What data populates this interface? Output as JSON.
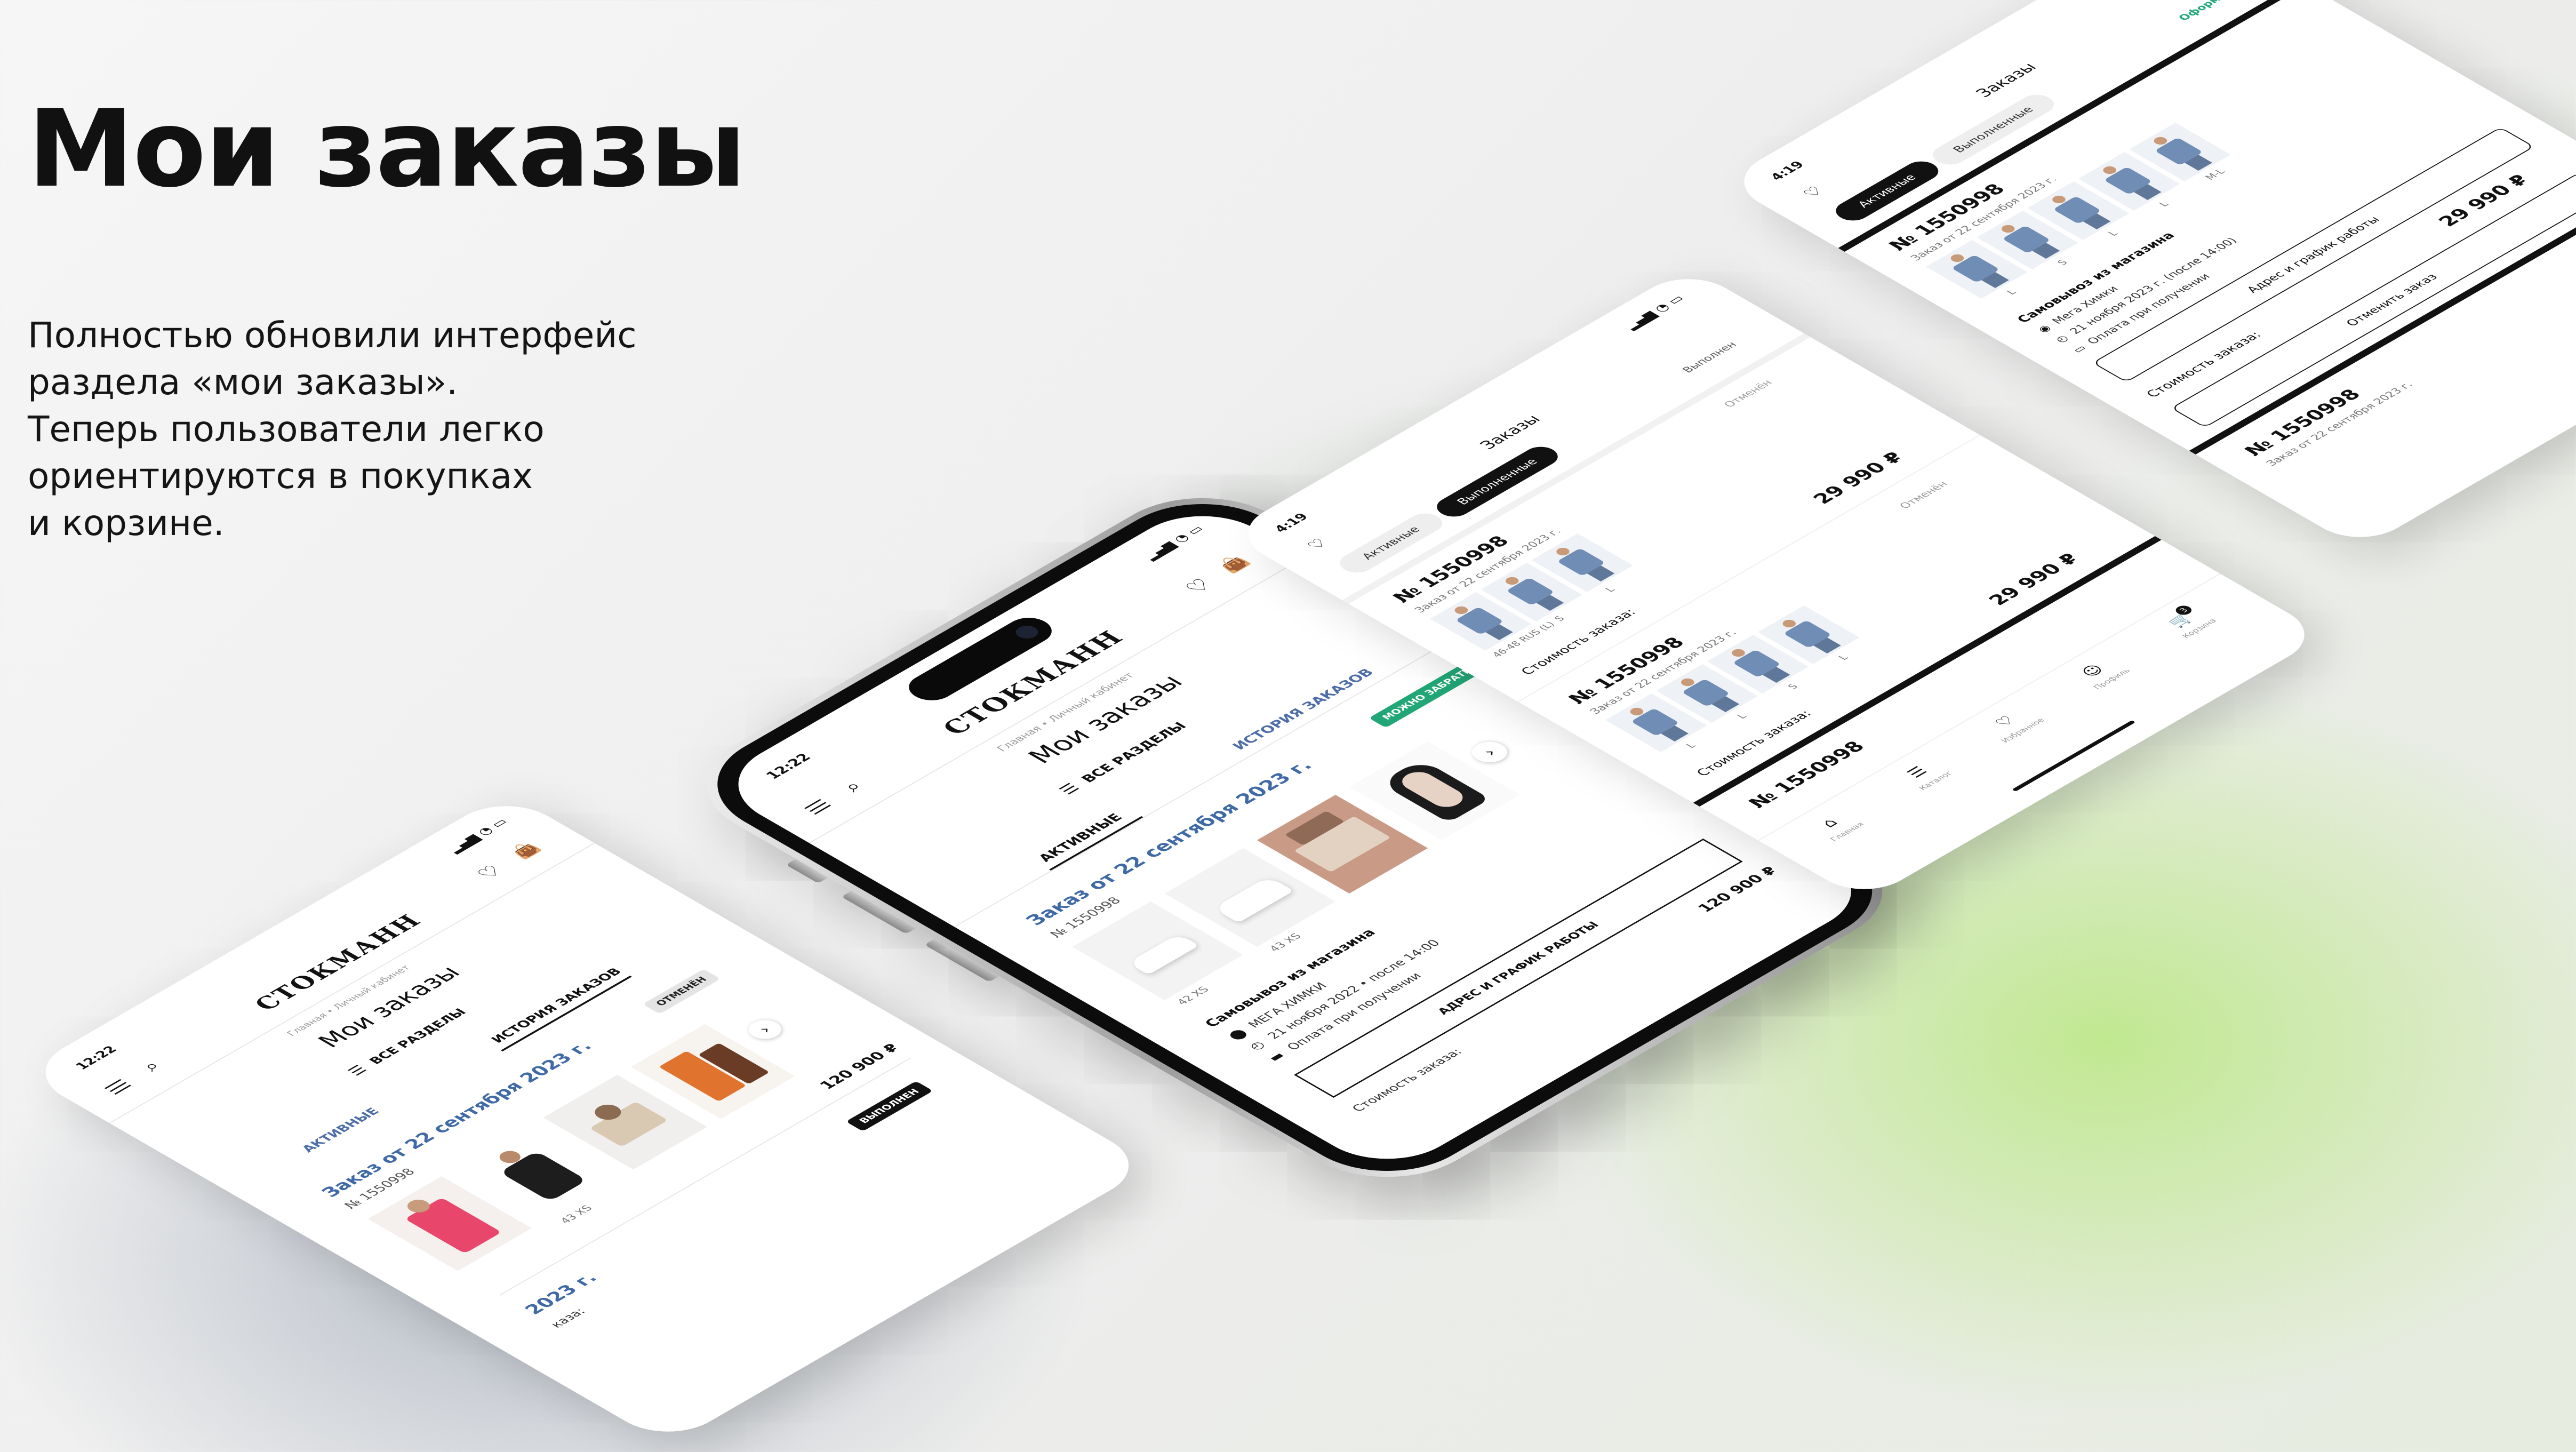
{
  "hero": {
    "title": "Мои заказы",
    "lead": [
      "Полностью обновили интерфейс",
      "раздела «мои заказы».",
      "Теперь пользователи легко",
      "ориентируются в покупках",
      "и корзине."
    ]
  },
  "web": {
    "time": "12:22",
    "logo": "СТОКМАНН",
    "breadcrumbs": "Главная • Личный кабинет",
    "page_title": "Мои заказы",
    "all_sections": "ВСЕ РАЗДЕЛЫ",
    "tabs": [
      "АКТИВНЫЕ",
      "ИСТОРИЯ ЗАКАЗОВ"
    ],
    "order_title": "Заказ от 22 сентября 2023 г.",
    "order_number": "№ 1550998",
    "next_arrow": "›",
    "total": "120 900 ₽",
    "cost_label": "Стоимость заказа:",
    "colors": {
      "blue": "#4d6ea8",
      "green": "#21a777"
    }
  },
  "phone_c": {
    "status": "МОЖНО ЗАБРАТЬ",
    "sizes": [
      "42 XS",
      "43 XS"
    ],
    "pickup_title": "Самовывоз из магазина",
    "store": "МЕГА ХИМКИ",
    "date_line": "21 ноября 2022 • после 14:00",
    "payment": "Оплата при получении",
    "schedule_btn": "АДРЕС И ГРАФИК РАБОТЫ"
  },
  "phone_a": {
    "status": "ОТМЕНЁН",
    "size": "43 XS",
    "second_title": "2023 г.",
    "second_status": "ВЫПОЛНЕН",
    "cost_partial": "каза:"
  },
  "app": {
    "time": "4:19",
    "title": "Заказы",
    "seg_active": "Активные",
    "seg_done": "Выполненные",
    "done_short": "Выполнен",
    "issued": "Оформлен",
    "cancelled": "Отменён",
    "order_number": "№ 1550998",
    "order_date": "Заказ от 22 сентября 2023 г.",
    "price": "29 990 ₽",
    "cost_label": "Стоимость заказа:",
    "sizes_b1": [
      "46-48 RUS (L)",
      "S",
      "L"
    ],
    "sizes_b2": [
      "L",
      "L",
      "S",
      "L"
    ],
    "sizes_d": [
      "L",
      "S",
      "L",
      "L",
      "M-L"
    ],
    "pickup_title": "Самовывоз из магазина",
    "store": "Мега Химки",
    "date_line": "21 ноября 2023 г. (после 14:00)",
    "payment": "Оплата при получении",
    "schedule_btn": "Адрес и график работы",
    "cancel_btn": "Отменить заказ",
    "cart_count": "3",
    "nav": [
      "Главная",
      "Каталог",
      "Избранное",
      "Профиль",
      "Корзина"
    ]
  }
}
